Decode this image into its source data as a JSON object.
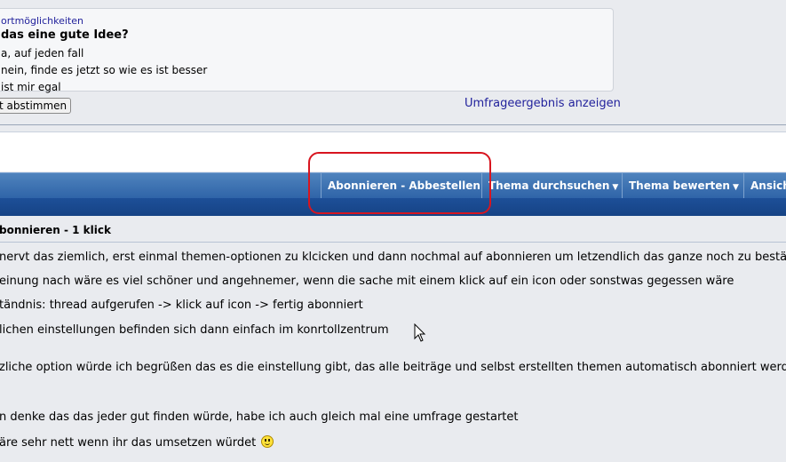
{
  "poll": {
    "heading": "ortmöglichkeiten",
    "question": "das eine gute Idee?",
    "options": [
      "a, auf jeden fall",
      "nein, finde es jetzt so wie es ist besser",
      "ist mir egal"
    ],
    "vote_button": "t abstimmen",
    "results_link": "Umfrageergebnis anzeigen"
  },
  "toolbar": {
    "subscribe": "Abonnieren - Abbestellen",
    "search": "Thema durchsuchen",
    "rate": "Thema bewerten",
    "view": "Ansich"
  },
  "post": {
    "title": "bonnieren - 1 klick",
    "lines": [
      "nervt das ziemlich, erst einmal themen-optionen zu klcicken und dann nochmal auf abonnieren um letzendlich das ganze noch zu bestätigen",
      "einung nach wäre es viel schöner und angehnemer, wenn die sache mit einem klick auf ein icon oder sonstwas gegessen wäre",
      "tändnis: thread aufgerufen -> klick auf icon -> fertig abonniert",
      "lichen einstellungen befinden sich dann einfach im konrtollzentrum",
      "zliche option würde ich begrüßen das es die einstellung gibt, das alle beiträge und selbst erstellten themen automatisch abonniert werden",
      "n denke das das jeder gut finden würde, habe ich auch gleich mal eine umfrage gestartet",
      "äre sehr nett wenn ihr das umsetzen würdet"
    ]
  },
  "icons": {
    "dropdown": "caret-down-icon",
    "smiley": "smiley-icon",
    "cursor": "mouse-cursor-icon"
  },
  "colors": {
    "toolbar_blue": "#3a70b1",
    "link_blue": "#22229c",
    "highlight_red": "#d8151f"
  }
}
